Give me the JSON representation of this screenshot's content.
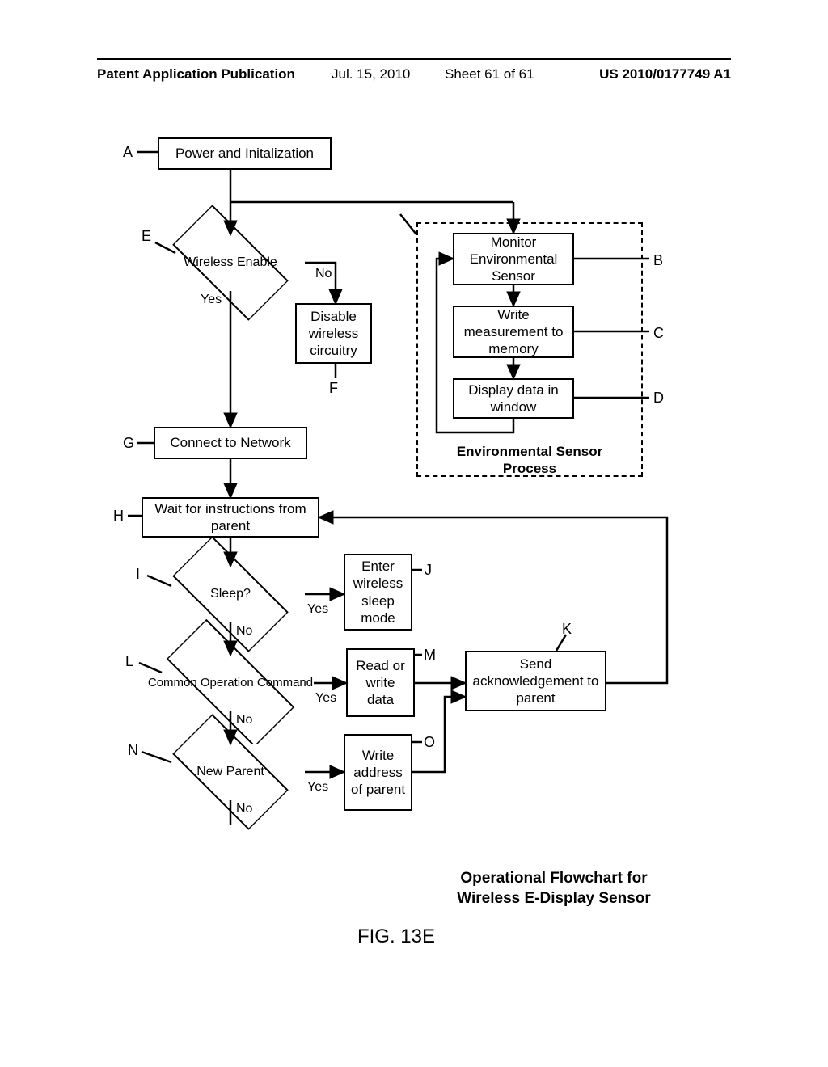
{
  "header": {
    "publication_label": "Patent Application Publication",
    "date": "Jul. 15, 2010",
    "sheet": "Sheet 61 of 61",
    "appnum": "US 2010/0177749 A1"
  },
  "nodes": {
    "A": "Power and Initalization",
    "E": "Wireless Enable",
    "F": "Disable wireless circuitry",
    "B": "Monitor Environmental Sensor",
    "C": "Write measurement to memory",
    "D": "Display data in window",
    "group": "Environmental Sensor Process",
    "G": "Connect to Network",
    "H": "Wait for instructions from parent",
    "I": "Sleep?",
    "J": "Enter wireless sleep mode",
    "K": "Send acknowledgement to parent",
    "L": "Common Operation Command",
    "M": "Read or write data",
    "N": "New Parent",
    "O": "Write address of parent"
  },
  "refs": {
    "A": "A",
    "B": "B",
    "C": "C",
    "D": "D",
    "E": "E",
    "F": "F",
    "G": "G",
    "H": "H",
    "I": "I",
    "J": "J",
    "K": "K",
    "L": "L",
    "M": "M",
    "N": "N",
    "O": "O"
  },
  "edges": {
    "yes": "Yes",
    "no": "No"
  },
  "caption": "Operational Flowchart for\nWireless E-Display Sensor",
  "figure": "FIG. 13E"
}
